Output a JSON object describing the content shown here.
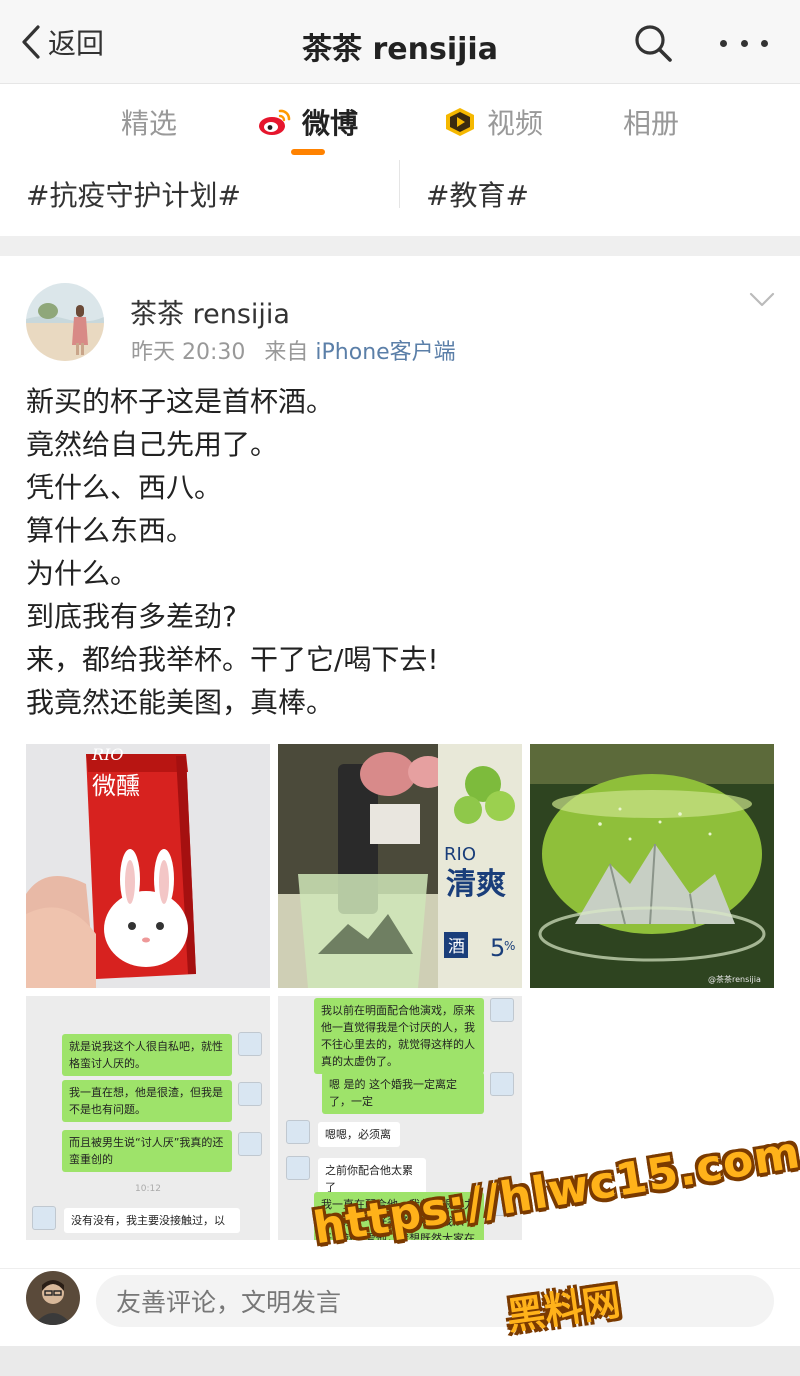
{
  "nav": {
    "back_label": "返回",
    "title": "茶茶 rensijia"
  },
  "tabs": [
    {
      "label": "精选"
    },
    {
      "label": "微博"
    },
    {
      "label": "视频"
    },
    {
      "label": "相册"
    }
  ],
  "topics": [
    "#抗疫守护计划#",
    "#教育#"
  ],
  "post": {
    "author": "茶茶 rensijia",
    "time": "昨天 20:30",
    "source_prefix": "来自",
    "source": "iPhone客户端",
    "lines": [
      "新买的杯子这是首杯酒。",
      "竟然给自己先用了。",
      "凭什么、西八。",
      "算什么东西。",
      "为什么。",
      "到底我有多差劲?",
      "来，都给我举杯。干了它/喝下去!",
      "我竟然还能美图，真棒。"
    ],
    "photos": {
      "p1_brand": "RIO",
      "p1_name": "微醺",
      "p2_brand": "RIO",
      "p2_name": "清爽",
      "p2_tag": "酒",
      "p2_pct": "5",
      "p3_credit": "@茶茶rensijia"
    },
    "chat1": [
      "就是说我这个人很自私吧，就性格蛮讨人厌的。",
      "我一直在想，他是很渣，但我是不是也有问题。",
      "而且被男生说“讨人厌”我真的还蛮重创的",
      "10:12",
      "没有没有，我主要没接触过，以"
    ],
    "chat2": [
      "我以前在明面配合他演戏，原来他一直觉得我是个讨厌的人，我不往心里去的，就觉得这样的人真的太虚伪了。",
      "嗯 是的 这个婚我一定离定了，一定",
      "嗯嗯，必须离",
      "之前你配合他太累了",
      "我一直在配合他，我曾经很努力的扮演一个好妻子，哪怕我从一开始就不爱他，我想既然大家在"
    ]
  },
  "comment_bar": {
    "placeholder": "友善评论，文明发言"
  },
  "watermark": {
    "url": "https://hlwc15.com",
    "name": "黑料网"
  },
  "colors": {
    "accent": "#ff8200",
    "link": "#5b7fa8",
    "chat_green": "#9ee36a"
  }
}
